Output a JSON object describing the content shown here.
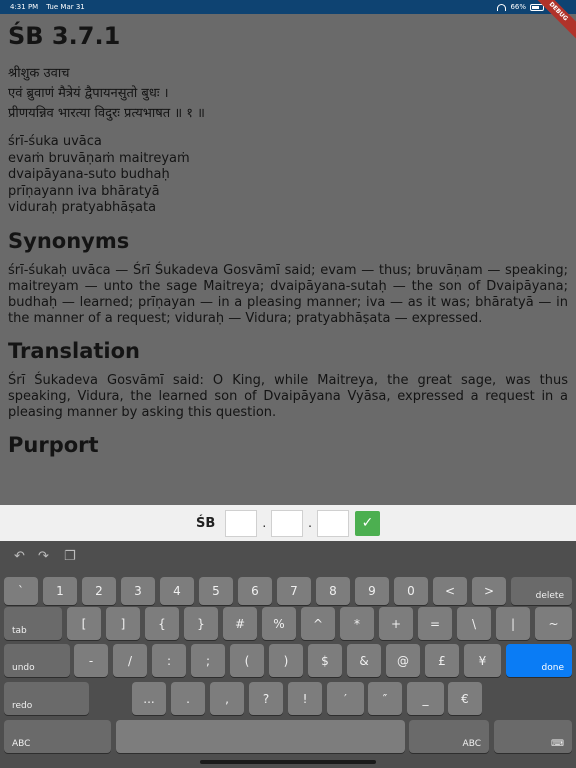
{
  "status_bar": {
    "time": "4:31 PM",
    "date": "Tue Mar 31",
    "battery": "66%",
    "ribbon": "DEBUG"
  },
  "verse": {
    "title": "ŚB 3.7.1",
    "devanagari": [
      "श्रीशुक उवाच",
      "एवं ब्रुवाणं मैत्रेयं द्वैपायनसुतो बुधः ।",
      "प्रीणयन्निव भारत्या विदुरः प्रत्यभाषत ॥ १ ॥"
    ],
    "transliteration": [
      "śrī-śuka uvāca",
      "evaṁ bruvāṇaṁ maitreyaṁ",
      "dvaipāyana-suto budhaḥ",
      "prīṇayann iva bhāratyā",
      "viduraḥ pratyabhāṣata"
    ],
    "synonyms_heading": "Synonyms",
    "synonyms": "śrī-śukaḥ uvāca — Śrī Śukadeva Gosvāmī said; evam — thus; bruvāṇam — speaking; maitreyam — unto the sage Maitreya; dvaipāyana-sutaḥ — the son of Dvaipāyana; budhaḥ — learned; prīṇayan — in a pleasing manner; iva — as it was; bhāratyā — in the manner of a request; viduraḥ — Vidura; pratyabhāṣata — expressed.",
    "translation_heading": "Translation",
    "translation": "Śrī Śukadeva Gosvāmī said: O King, while Maitreya, the great sage, was thus speaking, Vidura, the learned son of Dvaipāyana Vyāsa, expressed a request in a pleasing manner by asking this question.",
    "purport_heading": "Purport"
  },
  "jump_bar": {
    "label": "ŚB",
    "sep1": ".",
    "sep2": ".",
    "ok_symbol": "✓"
  },
  "keyboard": {
    "row1": [
      "`",
      "1",
      "2",
      "3",
      "4",
      "5",
      "6",
      "7",
      "8",
      "9",
      "0",
      "<",
      ">"
    ],
    "delete": "delete",
    "tab": "tab",
    "row2": [
      "[",
      "]",
      "{",
      "}",
      "#",
      "%",
      "^",
      "*",
      "+",
      "=",
      "\\",
      "|",
      "~"
    ],
    "undo": "undo",
    "row3": [
      "-",
      "/",
      ":",
      ";",
      "(",
      ")",
      "$",
      "&",
      "@",
      "£",
      "¥"
    ],
    "done": "done",
    "redo": "redo",
    "row4": [
      "...",
      ".",
      ",",
      "?",
      "!",
      "′",
      "″",
      "_",
      "€"
    ],
    "abc_left": "ABC",
    "abc_right": "ABC",
    "keyboard_icon": "⌨",
    "toolbar_undo": "↶",
    "toolbar_redo": "↷",
    "toolbar_paste": "❐"
  }
}
